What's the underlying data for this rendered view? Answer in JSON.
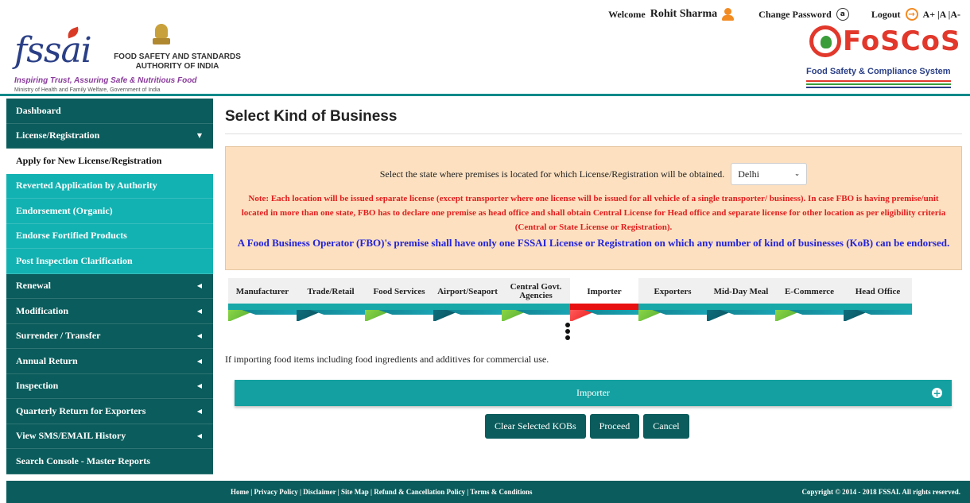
{
  "topbar": {
    "welcome": "Welcome",
    "username": "Rohit Sharma",
    "change_password": "Change Password",
    "logout": "Logout",
    "font_sizes": "A+ |A |A-"
  },
  "fssai": {
    "wordmark": "fssai",
    "org_line1": "FOOD SAFETY AND STANDARDS",
    "org_line2": "AUTHORITY OF INDIA",
    "tagline": "Inspiring Trust, Assuring Safe & Nutritious Food",
    "ministry": "Ministry of Health and Family Welfare, Government of India"
  },
  "foscos": {
    "wordmark": "FoSCoS",
    "subtitle": "Food Safety & Compliance System"
  },
  "sidebar": {
    "items": [
      {
        "label": "Dashboard",
        "arrow": ""
      },
      {
        "label": "License/Registration",
        "arrow": "▼"
      },
      {
        "label": "Apply for New License/Registration",
        "arrow": ""
      },
      {
        "label": "Reverted Application by Authority",
        "arrow": ""
      },
      {
        "label": "Endorsement (Organic)",
        "arrow": ""
      },
      {
        "label": "Endorse Fortified Products",
        "arrow": ""
      },
      {
        "label": "Post Inspection Clarification",
        "arrow": ""
      },
      {
        "label": "Renewal",
        "arrow": "◀"
      },
      {
        "label": "Modification",
        "arrow": "◀"
      },
      {
        "label": "Surrender / Transfer",
        "arrow": "◀"
      },
      {
        "label": "Annual Return",
        "arrow": "◀"
      },
      {
        "label": "Inspection",
        "arrow": "◀"
      },
      {
        "label": "Quarterly Return for Exporters",
        "arrow": "◀"
      },
      {
        "label": "View SMS/EMAIL History",
        "arrow": "◀"
      },
      {
        "label": "Search Console - Master Reports",
        "arrow": ""
      }
    ]
  },
  "main": {
    "title": "Select Kind of Business",
    "state_prompt": "Select the state where premises is located for which License/Registration will be obtained.",
    "state_value": "Delhi",
    "note_red": "Note: Each location will be issued separate license (except transporter where one license will be issued for all vehicle of a single transporter/ business). In case FBO is having premise/unit located in more than one state, FBO has to declare one premise as head office and shall obtain Central License for Head office and separate license for other location as per eligibility criteria (Central or State License or Registration).",
    "note_blue": "A Food Business Operator (FBO)'s premise shall have only one FSSAI License or Registration on which any number of kind of businesses (KoB) can be endorsed.",
    "tabs": [
      {
        "label": "Manufacturer"
      },
      {
        "label": "Trade/Retail"
      },
      {
        "label": "Food Services"
      },
      {
        "label": "Airport/Seaport"
      },
      {
        "label": "Central Govt. Agencies"
      },
      {
        "label": "Importer"
      },
      {
        "label": "Exporters"
      },
      {
        "label": "Mid-Day Meal"
      },
      {
        "label": "E-Commerce"
      },
      {
        "label": "Head Office"
      }
    ],
    "kob_description": "If importing food items including food ingredients and additives for commercial use.",
    "importer_bar": "Importer",
    "buttons": {
      "clear": "Clear Selected KOBs",
      "proceed": "Proceed",
      "cancel": "Cancel"
    }
  },
  "footer": {
    "links": "Home | Privacy Policy | Disclaimer | Site Map | Refund & Cancellation Policy | Terms & Conditions",
    "copyright": "Copyright © 2014 - 2018 FSSAI. All rights reserved."
  },
  "colors": {
    "sidebar_dark": "#0b5c5c",
    "sidebar_light": "#13b2b2",
    "active_tab": "#e81010",
    "notice_bg": "#fce0c0",
    "note_red": "#e11d1d",
    "note_blue": "#2222dd"
  }
}
